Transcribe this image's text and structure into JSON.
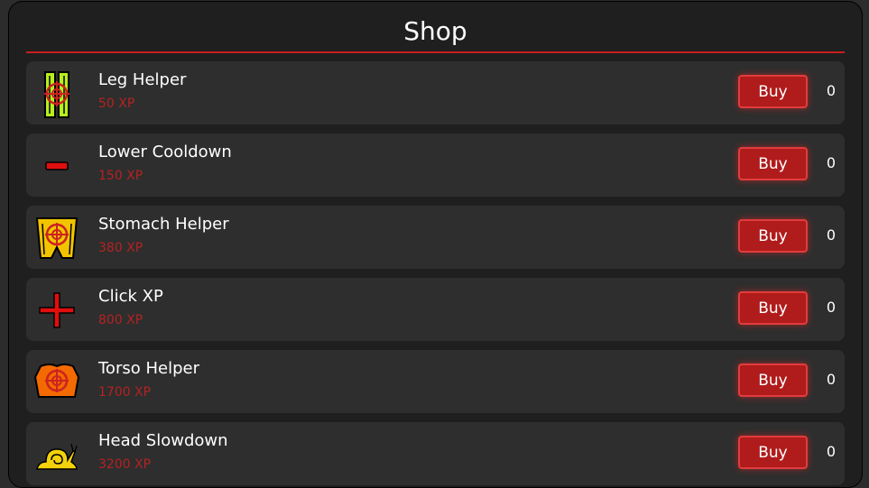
{
  "shop": {
    "title": "Shop",
    "items": [
      {
        "name": "Leg Helper",
        "price": "50 XP",
        "buy_label": "Buy",
        "count": "0",
        "icon": "legs-target-icon"
      },
      {
        "name": "Lower Cooldown",
        "price": "150 XP",
        "buy_label": "Buy",
        "count": "0",
        "icon": "minus-icon"
      },
      {
        "name": "Stomach Helper",
        "price": "380 XP",
        "buy_label": "Buy",
        "count": "0",
        "icon": "stomach-target-icon"
      },
      {
        "name": "Click XP",
        "price": "800 XP",
        "buy_label": "Buy",
        "count": "0",
        "icon": "plus-icon"
      },
      {
        "name": "Torso Helper",
        "price": "1700 XP",
        "buy_label": "Buy",
        "count": "0",
        "icon": "torso-target-icon"
      },
      {
        "name": "Head Slowdown",
        "price": "3200 XP",
        "buy_label": "Buy",
        "count": "0",
        "icon": "snail-icon"
      }
    ]
  },
  "colors": {
    "accent": "#c81e1e",
    "price_text": "#b52222",
    "panel_bg": "#1f1f1f",
    "row_bg": "#2e2e2e"
  }
}
